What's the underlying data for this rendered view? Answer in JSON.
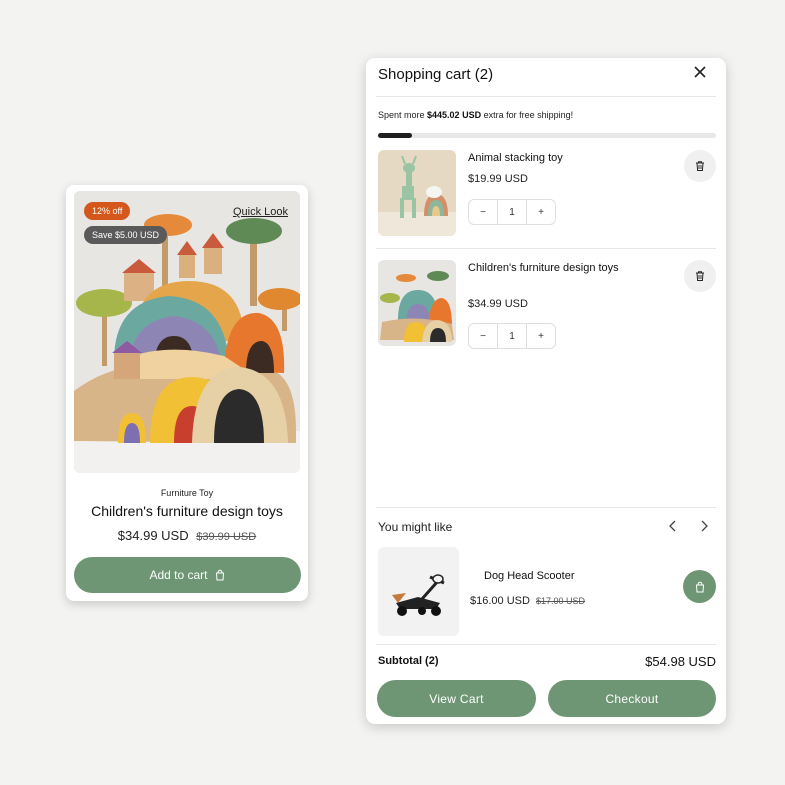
{
  "product_card": {
    "badge_discount": "12% off",
    "badge_save": "Save $5.00 USD",
    "quick_look": "Quick Look",
    "category": "Furniture Toy",
    "title": "Children's furniture design toys",
    "price": "$34.99 USD",
    "compare_price": "$39.99 USD",
    "add_to_cart": "Add to cart"
  },
  "cart": {
    "title": "Shopping cart (2)",
    "shipping_prefix": "Spent more ",
    "shipping_amount": "$445.02 USD",
    "shipping_suffix": " extra for free shipping!",
    "shipping_progress": 0.1,
    "items": [
      {
        "name": "Animal stacking toy",
        "price": "$19.99 USD",
        "quantity": "1"
      },
      {
        "name": "Children's furniture design toys",
        "price": "$34.99 USD",
        "quantity": "1"
      }
    ],
    "qty_minus": "−",
    "qty_plus": "+",
    "recommendations_title": "You might like",
    "recommendation": {
      "name": "Dog Head Scooter",
      "price": "$16.00 USD",
      "compare_price": "$17.00 USD"
    },
    "subtotal_label": "Subtotal (2)",
    "subtotal_value": "$54.98 USD",
    "view_cart": "View Cart",
    "checkout": "Checkout"
  },
  "icons": [
    "close-icon",
    "trash-icon",
    "bag-icon",
    "chevron-left-icon",
    "chevron-right-icon"
  ],
  "colors": {
    "accent": "#6e9674",
    "discount_badge": "#d4571c",
    "save_badge": "#5a5a5a",
    "background": "#f3f4f2"
  }
}
